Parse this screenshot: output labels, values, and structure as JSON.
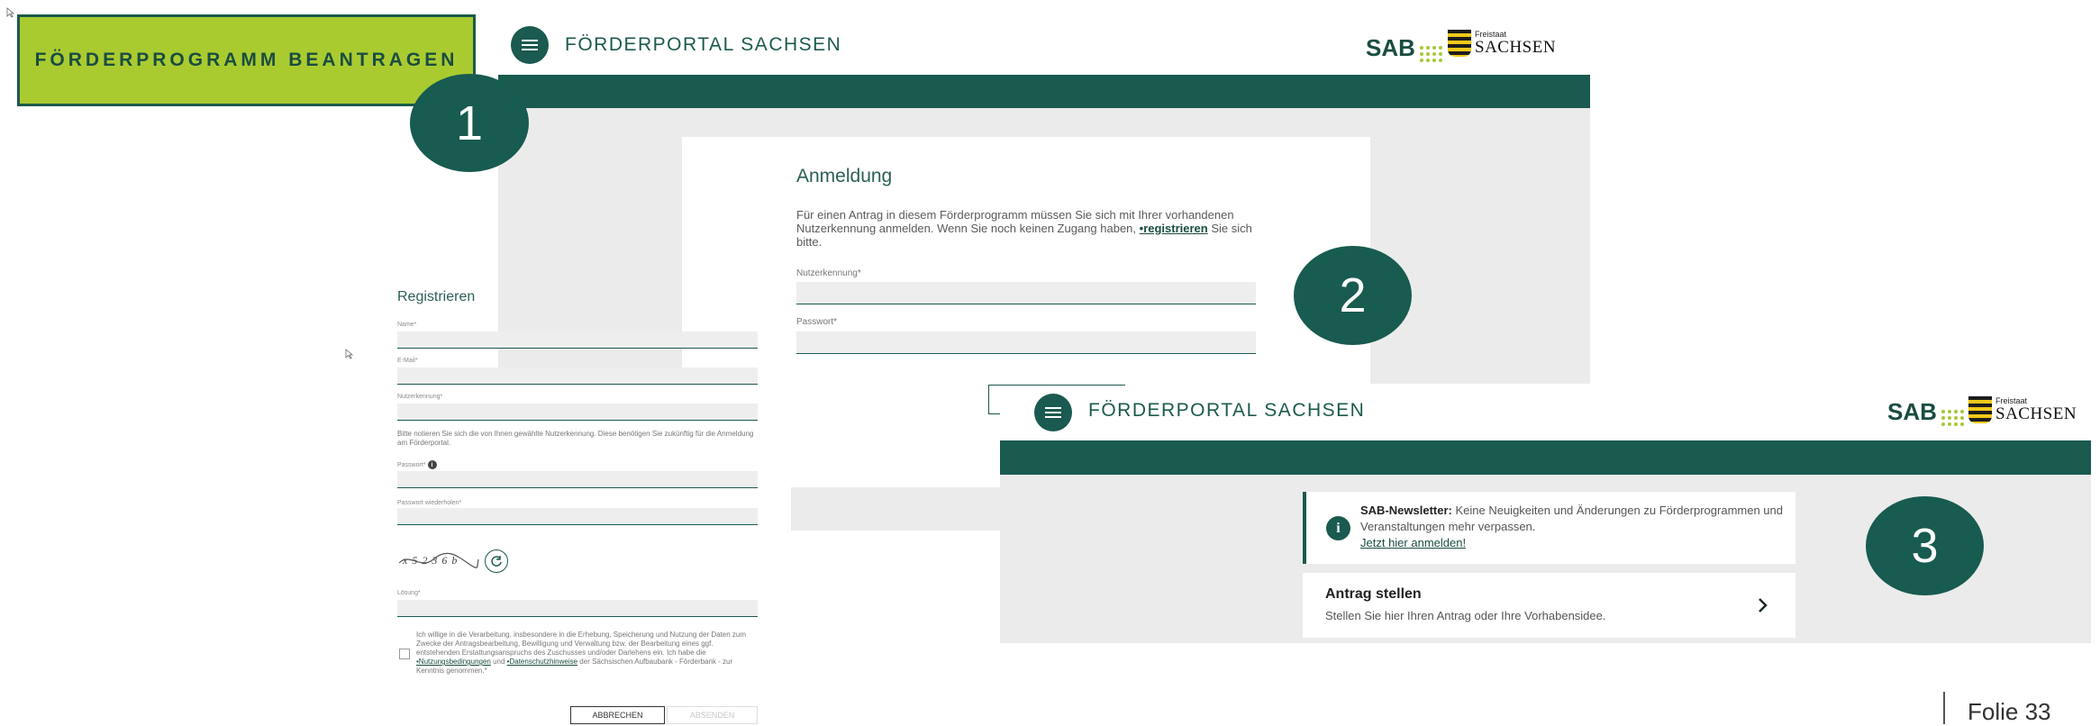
{
  "headline": "FÖRDERPROGRAMM BEANTRAGEN",
  "portal": {
    "title": "FÖRDERPORTAL SACHSEN",
    "sab_logo": "SAB",
    "freistaat": "Freistaat",
    "sachsen": "SACHSEN"
  },
  "markers": [
    "1",
    "2",
    "3"
  ],
  "login": {
    "title": "Anmeldung",
    "text_before": "Für einen Antrag in diesem Förderprogramm müssen Sie sich mit Ihrer vorhandenen Nutzerkennung anmelden. Wenn Sie noch keinen Zugang haben, ",
    "register_link": "•registrieren",
    "text_after": " Sie sich bitte.",
    "username_label": "Nutzerkennung*",
    "password_label": "Passwort*"
  },
  "register": {
    "title": "Registrieren",
    "name_label": "Name*",
    "email_label": "E-Mail*",
    "username_label": "Nutzerkennung*",
    "username_hint": "Bitte notieren Sie sich die von Ihnen gewählte Nutzerkennung. Diese benötigen Sie zukünftig für die Anmeldung am Förderportal.",
    "password_label": "Passwort*",
    "password_repeat_label": "Passwort wiederholen*",
    "captcha": "x 5 2 3 6 b",
    "solution_label": "Lösung*",
    "consent_1": "Ich willige in die Verarbeitung, insbesondere in die Erhebung, Speicherung und Nutzung der Daten zum Zwecke der Antragsbearbeitung, Bewilligung und Verwaltung bzw. der Bearbeitung eines ggf. entstehenden Erstattungsanspruchs des Zuschusses und/oder Darlehens ein. Ich habe die ",
    "consent_link_1": "•Nutzungsbedingungen",
    "consent_2": " und ",
    "consent_link_2": "•Datenschutzhinweise",
    "consent_3": " der Sächsischen Aufbaubank - Förderbank - zur Kenntnis genommen.*",
    "cancel_label": "ABBRECHEN",
    "submit_label": "ABSENDEN"
  },
  "dashboard": {
    "newsletter_bold": "SAB-Newsletter:",
    "newsletter_text": " Keine Neuigkeiten und Änderungen zu Förderprogrammen und Veranstaltungen mehr verpassen.",
    "newsletter_link": "Jetzt hier anmelden!",
    "card_title": "Antrag stellen",
    "card_subtitle": "Stellen Sie hier Ihren Antrag oder Ihre Vorhabensidee."
  },
  "footer": "Folie 33"
}
